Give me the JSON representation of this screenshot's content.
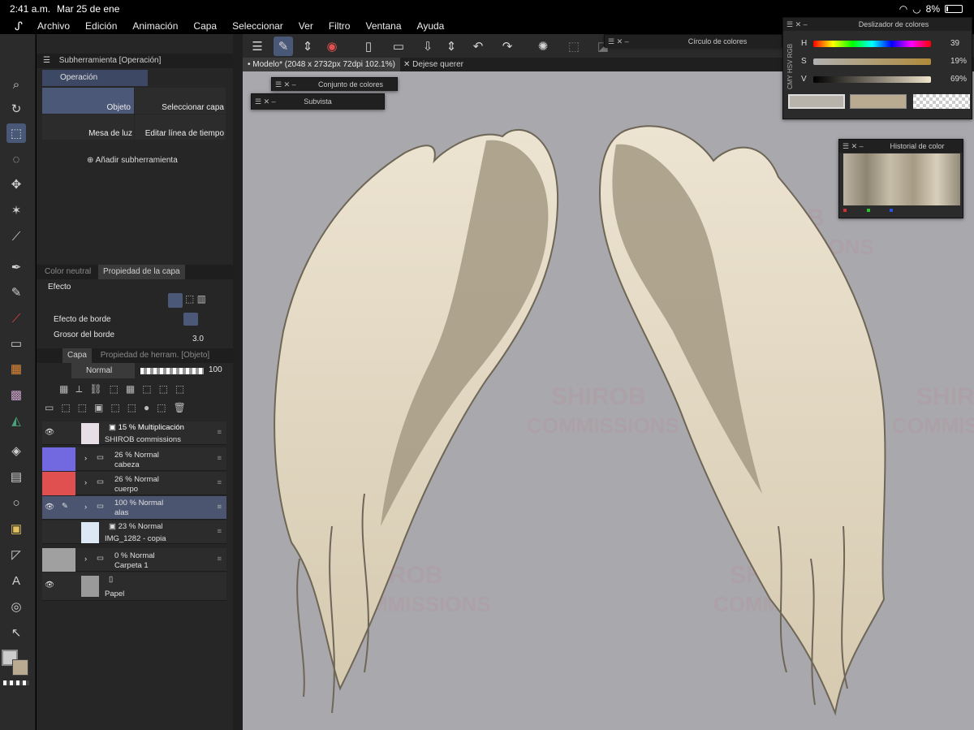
{
  "status": {
    "time": "2:41 a.m.",
    "date": "Mar 25 de ene",
    "battery": "8%"
  },
  "menu": [
    "Archivo",
    "Edición",
    "Animación",
    "Capa",
    "Seleccionar",
    "Ver",
    "Filtro",
    "Ventana",
    "Ayuda"
  ],
  "subtool": {
    "title": "Subherramienta [Operación]",
    "group": "Operación",
    "items": [
      "Objeto",
      "Seleccionar capa",
      "Mesa de luz",
      "Editar línea de tiempo"
    ],
    "add_label": "Añadir subherramienta"
  },
  "property": {
    "tabs": [
      "Color neutral",
      "Propiedad de la capa"
    ],
    "section": "Efecto",
    "border_effect": "Efecto de borde",
    "border_width_label": "Grosor del borde",
    "border_width_value": "3.0"
  },
  "layers_panel": {
    "tabs": [
      "Capa",
      "Propiedad de herram. [Objeto]"
    ],
    "blend_mode": "Normal",
    "opacity": "100",
    "layers": [
      {
        "opacity_mode": "15 % Multiplicación",
        "name": "SHIROB commissions"
      },
      {
        "opacity_mode": "26 % Normal",
        "name": "cabeza"
      },
      {
        "opacity_mode": "26 % Normal",
        "name": "cuerpo"
      },
      {
        "opacity_mode": "100 % Normal",
        "name": "alas"
      },
      {
        "opacity_mode": "23 % Normal",
        "name": "IMG_1282 - copia"
      },
      {
        "opacity_mode": "0 % Normal",
        "name": "Carpeta 1"
      },
      {
        "opacity_mode": "",
        "name": "Papel"
      }
    ]
  },
  "canvas_tabs": [
    "Modelo* (2048 x 2732px 72dpi 102.1%)",
    "Dejese querer"
  ],
  "palettes": {
    "color_circle": "Círculo de colores",
    "color_set": "Conjunto de colores",
    "subview": "Subvista",
    "color_slider": {
      "title": "Deslizador de colores",
      "side_labels": [
        "RGB",
        "HSV",
        "CMY"
      ],
      "rows": [
        {
          "label": "H",
          "value": "39"
        },
        {
          "label": "S",
          "value": "19%"
        },
        {
          "label": "V",
          "value": "69%"
        }
      ]
    },
    "color_history": "Historial de color"
  },
  "watermark": {
    "line1": "SHIROB",
    "line2": "COMMISSIONS"
  },
  "colors": {
    "accent": "#4a5878",
    "canvas": "#a8a8ad",
    "wing_light": "#e6dcc8",
    "wing_dark": "#9e9480"
  }
}
